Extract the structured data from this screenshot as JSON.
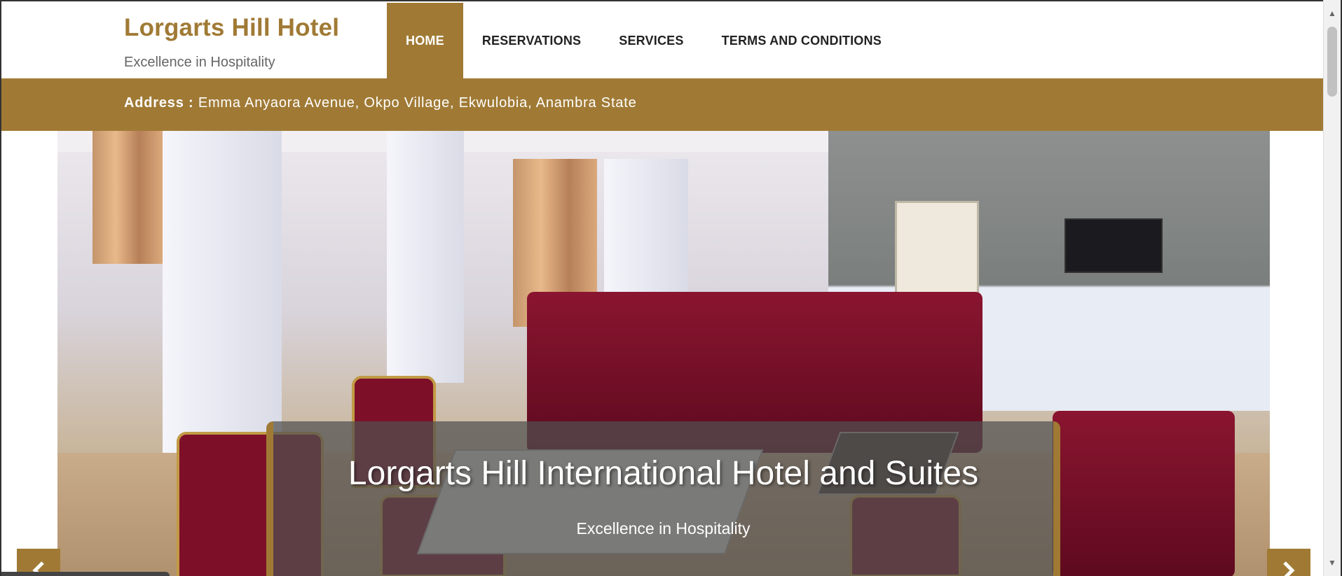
{
  "header": {
    "brand_title": "Lorgarts Hill Hotel",
    "brand_tagline": "Excellence in Hospitality"
  },
  "nav": {
    "items": [
      {
        "label": "HOME",
        "active": true
      },
      {
        "label": "RESERVATIONS",
        "active": false
      },
      {
        "label": "SERVICES",
        "active": false
      },
      {
        "label": "TERMS AND CONDITIONS",
        "active": false
      }
    ]
  },
  "address": {
    "label": "Address :",
    "value": "Emma Anyaora Avenue, Okpo Village, Ekwulobia, Anambra State"
  },
  "carousel": {
    "caption_title": "Lorgarts Hill International Hotel and Suites",
    "caption_subtitle": "Excellence in Hospitality",
    "prev_icon": "chevron-left-icon",
    "next_icon": "chevron-right-icon"
  },
  "colors": {
    "accent": "#a07a35",
    "nav_text": "#222222",
    "tagline": "#666666"
  }
}
